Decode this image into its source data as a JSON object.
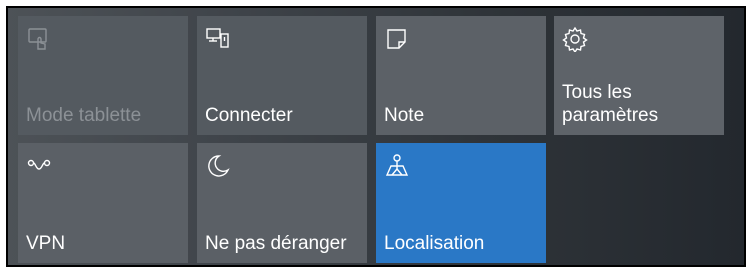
{
  "quick_actions": [
    {
      "label": "Mode tablette",
      "icon": "tablet-mode-icon",
      "state": "disabled"
    },
    {
      "label": "Connecter",
      "icon": "connect-icon",
      "state": "normal"
    },
    {
      "label": "Note",
      "icon": "note-icon",
      "state": "normal"
    },
    {
      "label": "Tous les paramètres",
      "icon": "settings-gear-icon",
      "state": "normal"
    },
    {
      "label": "VPN",
      "icon": "vpn-icon",
      "state": "normal"
    },
    {
      "label": "Ne pas déranger",
      "icon": "moon-icon",
      "state": "normal"
    },
    {
      "label": "Localisation",
      "icon": "location-icon",
      "state": "active"
    }
  ],
  "colors": {
    "accent": "#2a78c6",
    "tile": "#545a60",
    "disabled_text": "#8c9196"
  }
}
